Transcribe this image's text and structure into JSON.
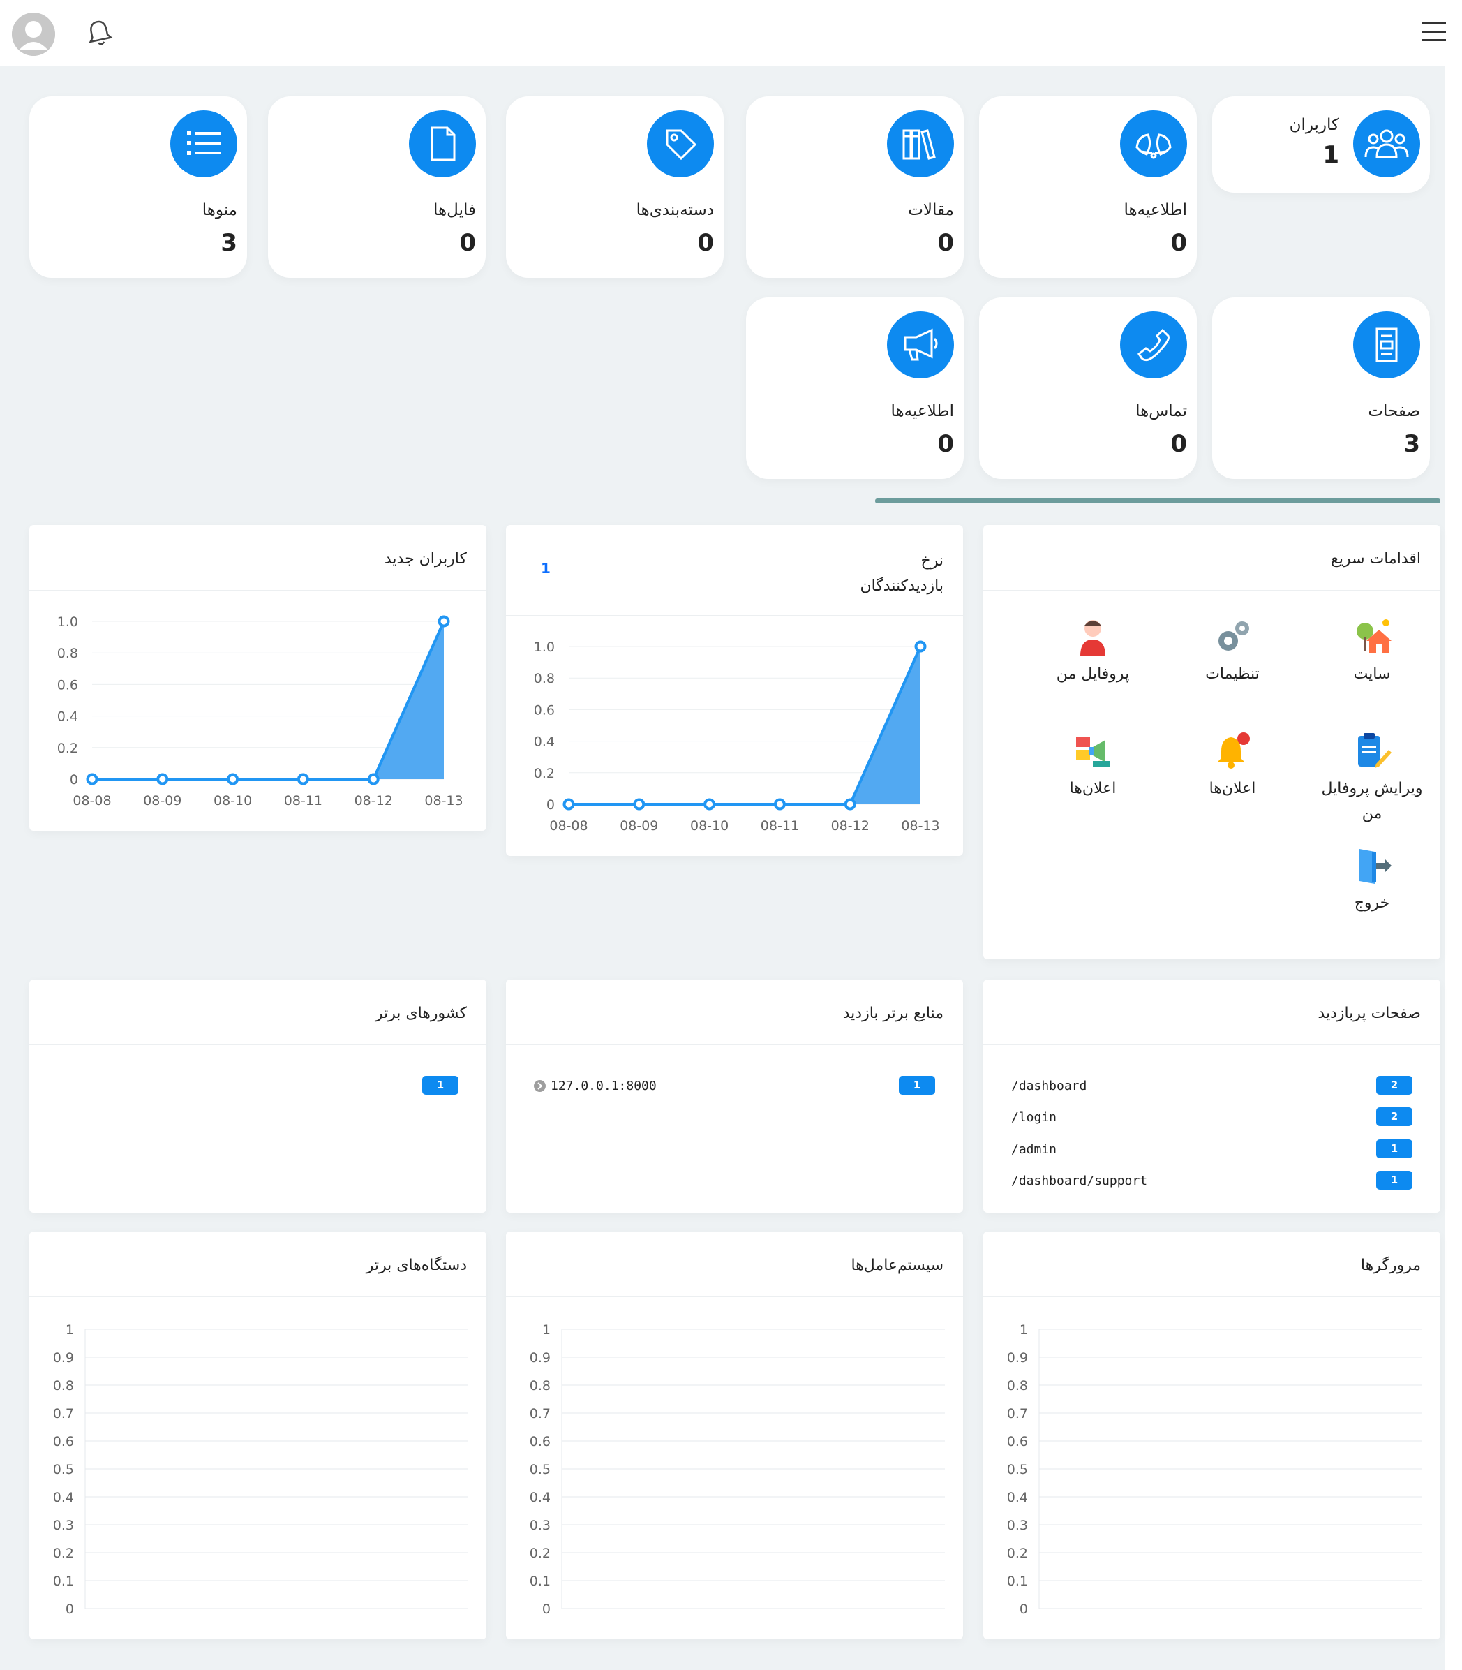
{
  "header": {
    "avatar_icon": "avatar-icon",
    "bell_icon": "bell-icon",
    "menu_icon": "hamburger-menu-icon"
  },
  "stats": {
    "users": {
      "label": "کاربران",
      "value": "1",
      "icon": "users-icon"
    },
    "notices1": {
      "label": "اطلاعیه‌ها",
      "value": "0",
      "icon": "bells-icon"
    },
    "articles": {
      "label": "مقالات",
      "value": "0",
      "icon": "books-icon"
    },
    "categories": {
      "label": "دسته‌بندی‌ها",
      "value": "0",
      "icon": "tag-icon"
    },
    "files": {
      "label": "فایل‌ها",
      "value": "0",
      "icon": "file-icon"
    },
    "menus": {
      "label": "منوها",
      "value": "3",
      "icon": "list-icon"
    },
    "pages": {
      "label": "صفحات",
      "value": "3",
      "icon": "document-icon"
    },
    "contacts": {
      "label": "تماس‌ها",
      "value": "0",
      "icon": "phone-icon"
    },
    "notices2": {
      "label": "اطلاعیه‌ها",
      "value": "0",
      "icon": "megaphone-icon"
    }
  },
  "quick_actions": {
    "title": "اقدامات سریع",
    "items": [
      {
        "label": "سایت",
        "icon": "house-icon"
      },
      {
        "label": "تنظیمات",
        "icon": "gears-icon"
      },
      {
        "label": "پروفایل من",
        "icon": "person-icon"
      },
      {
        "label": "ویرایش پروفایل من",
        "icon": "edit-clipboard-icon"
      },
      {
        "label": "اعلان‌ها",
        "icon": "notification-bell-icon"
      },
      {
        "label": "اعلان‌ها",
        "icon": "announcement-icon"
      },
      {
        "label": "خروج",
        "icon": "logout-door-icon"
      }
    ]
  },
  "visitor_rate": {
    "title_line1": "نرخ",
    "title_line2": "بازدیدکنندگان",
    "value": "1"
  },
  "new_users": {
    "title": "کاربران جدید"
  },
  "chart_data": [
    {
      "type": "area",
      "categories": [
        "08-08",
        "08-09",
        "08-10",
        "08-11",
        "08-12",
        "08-13"
      ],
      "values": [
        0,
        0,
        0,
        0,
        0,
        1
      ],
      "yticks": [
        "0",
        "0.2",
        "0.4",
        "0.6",
        "0.8",
        "1.0"
      ],
      "ylim": [
        0,
        1
      ],
      "color": "#2196f3"
    },
    {
      "type": "area",
      "categories": [
        "08-08",
        "08-09",
        "08-10",
        "08-11",
        "08-12",
        "08-13"
      ],
      "values": [
        0,
        0,
        0,
        0,
        0,
        1
      ],
      "yticks": [
        "0",
        "0.2",
        "0.4",
        "0.6",
        "0.8",
        "1.0"
      ],
      "ylim": [
        0,
        1
      ],
      "color": "#2196f3"
    },
    {
      "type": "bar",
      "title": "مرورگرها",
      "categories": [],
      "values": [],
      "yticks": [
        "0",
        "0.1",
        "0.2",
        "0.3",
        "0.4",
        "0.5",
        "0.6",
        "0.7",
        "0.8",
        "0.9",
        "1"
      ],
      "ylim": [
        0,
        1
      ]
    },
    {
      "type": "bar",
      "title": "سیستم‌عامل‌ها",
      "categories": [],
      "values": [],
      "yticks": [
        "0",
        "0.1",
        "0.2",
        "0.3",
        "0.4",
        "0.5",
        "0.6",
        "0.7",
        "0.8",
        "0.9",
        "1"
      ],
      "ylim": [
        0,
        1
      ]
    },
    {
      "type": "bar",
      "title": "دستگاه‌های برتر",
      "categories": [],
      "values": [],
      "yticks": [
        "0",
        "0.1",
        "0.2",
        "0.3",
        "0.4",
        "0.5",
        "0.6",
        "0.7",
        "0.8",
        "0.9",
        "1"
      ],
      "ylim": [
        0,
        1
      ]
    }
  ],
  "popular_pages": {
    "title": "صفحات پربازدید",
    "rows": [
      {
        "path": "/dashboard",
        "count": "2"
      },
      {
        "path": "/login",
        "count": "2"
      },
      {
        "path": "/admin",
        "count": "1"
      },
      {
        "path": "/dashboard/support",
        "count": "1"
      }
    ]
  },
  "top_sources": {
    "title": "منابع برتر بازدید",
    "rows": [
      {
        "source": "127.0.0.1:8000",
        "count": "1"
      }
    ]
  },
  "top_countries": {
    "title": "کشورهای برتر",
    "rows": [
      {
        "count": "1"
      }
    ]
  },
  "colors": {
    "accent": "#0d8af0",
    "background": "#eef2f4",
    "divider": "#6c9c9c"
  }
}
